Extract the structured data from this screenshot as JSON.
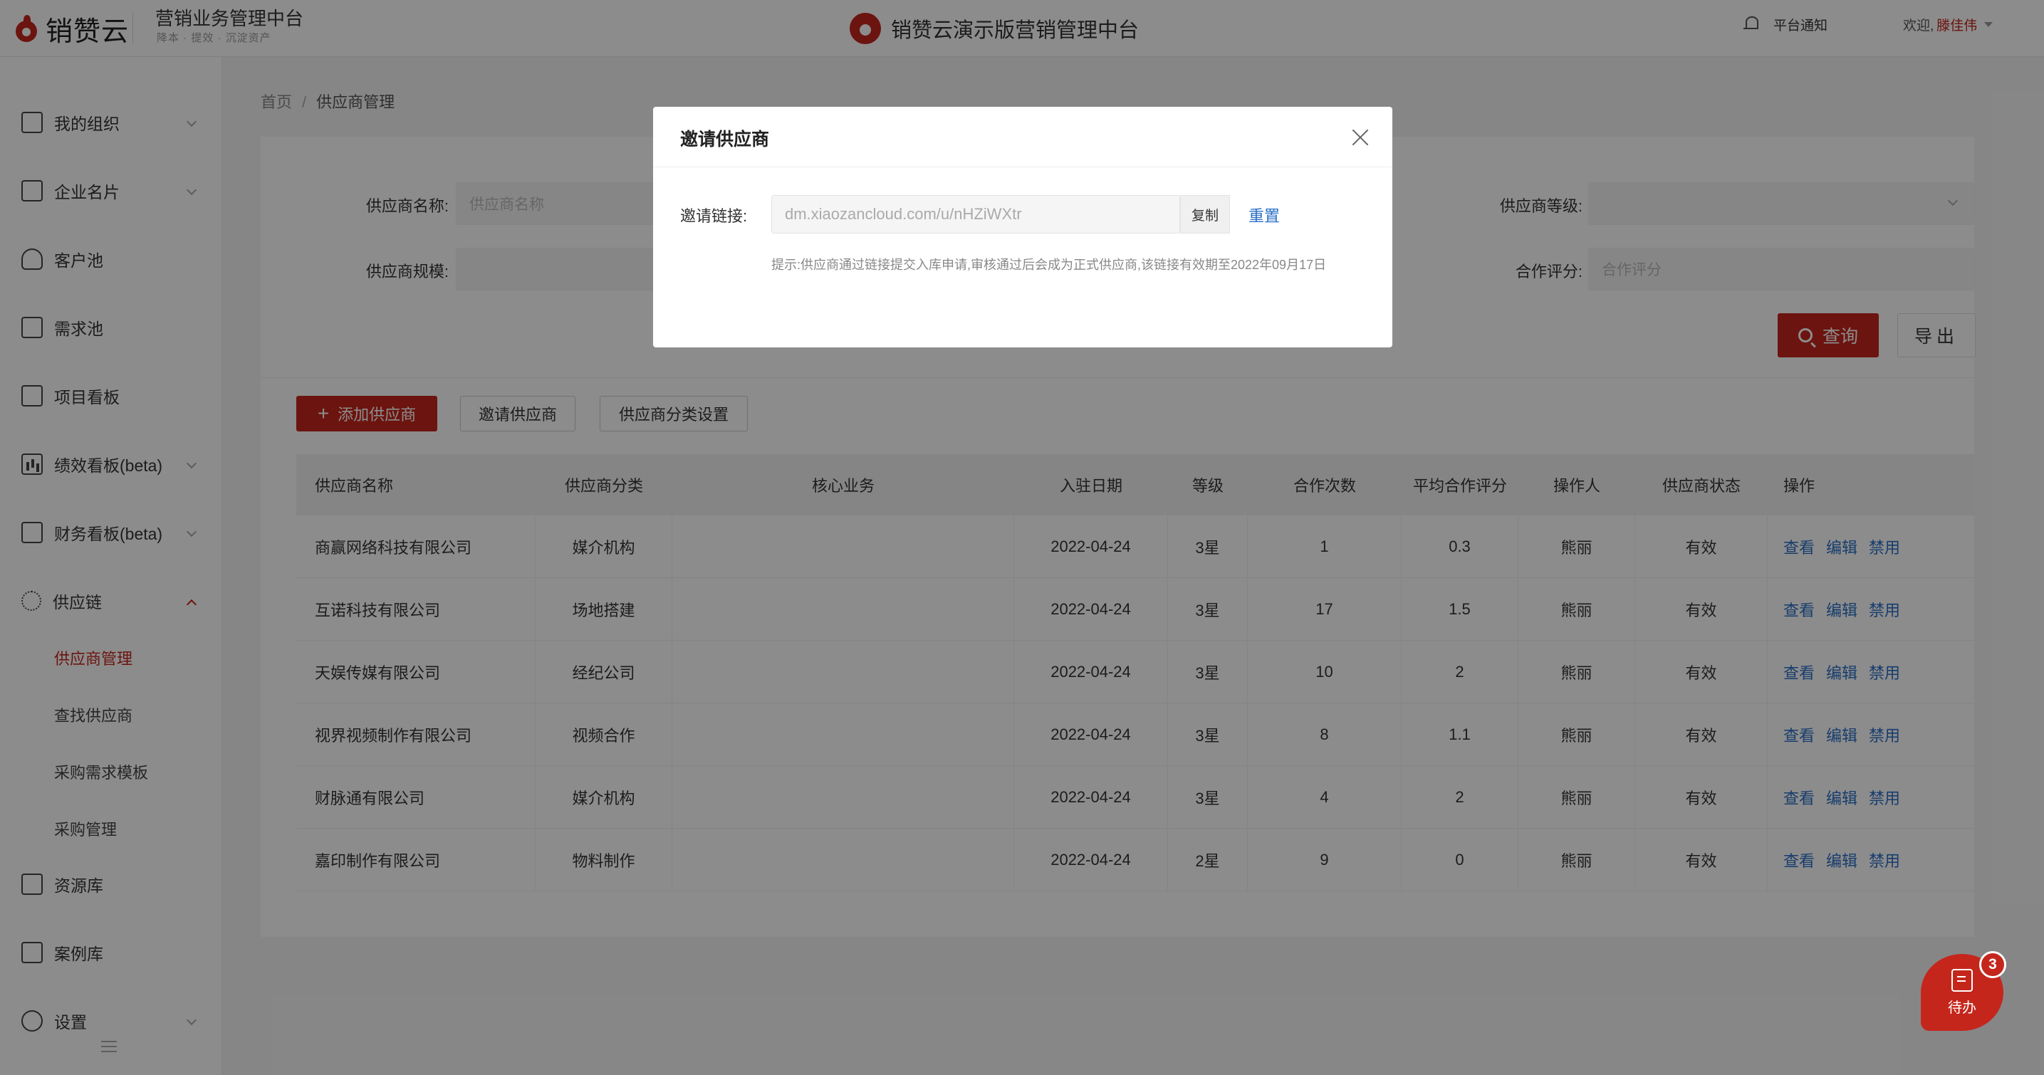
{
  "header": {
    "logo_text": "销赞云",
    "system_title": "营销业务管理中台",
    "system_subtitle": "降本 · 提效 · 沉淀资产",
    "center_title": "销赞云演示版营销管理中台",
    "notice_label": "平台通知",
    "welcome_label": "欢迎,",
    "username": "滕佳伟"
  },
  "sidebar": {
    "items": [
      {
        "label": "我的组织",
        "icon": "org-icon"
      },
      {
        "label": "企业名片",
        "icon": "building-icon"
      },
      {
        "label": "客户池",
        "icon": "user-icon"
      },
      {
        "label": "需求池",
        "icon": "document-icon"
      },
      {
        "label": "项目看板",
        "icon": "board-icon"
      },
      {
        "label": "绩效看板(beta)",
        "icon": "bar-chart-icon"
      },
      {
        "label": "财务看板(beta)",
        "icon": "yen-icon"
      },
      {
        "label": "供应链",
        "icon": "supply-chain-icon"
      },
      {
        "label": "资源库",
        "icon": "folder-icon"
      },
      {
        "label": "案例库",
        "icon": "presentation-icon"
      },
      {
        "label": "设置",
        "icon": "gear-icon"
      }
    ],
    "sub_items": [
      "供应商管理",
      "查找供应商",
      "采购需求模板",
      "采购管理"
    ]
  },
  "breadcrumb": {
    "home": "首页",
    "separator": "/",
    "current": "供应商管理"
  },
  "filters": {
    "name_label": "供应商名称:",
    "name_placeholder": "供应商名称",
    "level_label": "供应商等级:",
    "scale_label": "供应商规模:",
    "rating_label": "合作评分:",
    "rating_placeholder": "合作评分",
    "query_label": "查询",
    "export_label": "导出"
  },
  "actions": {
    "add_label": "添加供应商",
    "invite_label": "邀请供应商",
    "category_label": "供应商分类设置"
  },
  "table": {
    "headers": [
      "供应商名称",
      "供应商分类",
      "核心业务",
      "入驻日期",
      "等级",
      "合作次数",
      "平均合作评分",
      "操作人",
      "供应商状态",
      "操作"
    ],
    "op_labels": {
      "view": "查看",
      "edit": "编辑",
      "disable": "禁用"
    },
    "rows": [
      {
        "name": "商赢网络科技有限公司",
        "category": "媒介机构",
        "core": "",
        "date": "2022-04-24",
        "level": "3星",
        "count": "1",
        "rating": "0.3",
        "operator": "熊丽",
        "status": "有效"
      },
      {
        "name": "互诺科技有限公司",
        "category": "场地搭建",
        "core": "",
        "date": "2022-04-24",
        "level": "3星",
        "count": "17",
        "rating": "1.5",
        "operator": "熊丽",
        "status": "有效"
      },
      {
        "name": "天娱传媒有限公司",
        "category": "经纪公司",
        "core": "",
        "date": "2022-04-24",
        "level": "3星",
        "count": "10",
        "rating": "2",
        "operator": "熊丽",
        "status": "有效"
      },
      {
        "name": "视界视频制作有限公司",
        "category": "视频合作",
        "core": "",
        "date": "2022-04-24",
        "level": "3星",
        "count": "8",
        "rating": "1.1",
        "operator": "熊丽",
        "status": "有效"
      },
      {
        "name": "财脉通有限公司",
        "category": "媒介机构",
        "core": "",
        "date": "2022-04-24",
        "level": "3星",
        "count": "4",
        "rating": "2",
        "operator": "熊丽",
        "status": "有效"
      },
      {
        "name": "嘉印制作有限公司",
        "category": "物料制作",
        "core": "",
        "date": "2022-04-24",
        "level": "2星",
        "count": "9",
        "rating": "0",
        "operator": "熊丽",
        "status": "有效"
      }
    ]
  },
  "modal": {
    "title": "邀请供应商",
    "link_label": "邀请链接:",
    "link_value": "dm.xiaozancloud.com/u/nHZiWXtr",
    "copy_label": "复制",
    "reset_label": "重置",
    "tip": "提示:供应商通过链接提交入库申请,审核通过后会成为正式供应商,该链接有效期至2022年09月17日"
  },
  "todo": {
    "label": "待办",
    "badge": "3"
  },
  "colors": {
    "brand": "#c5261c",
    "link": "#2a6fc6"
  }
}
